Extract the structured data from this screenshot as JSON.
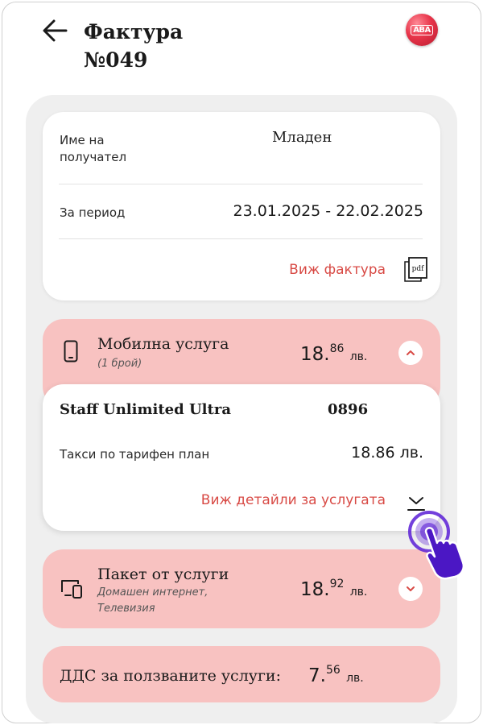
{
  "header": {
    "title_line1": "Фактура",
    "title_line2": "№049",
    "logo_text": "ABA"
  },
  "invoice": {
    "recipient_label_line1": "Име на",
    "recipient_label_line2": "получател",
    "recipient_value": "Младен",
    "period_label": "За период",
    "period_value": "23.01.2025  - 22.02.2025",
    "view_invoice_label": "Виж фактура",
    "pdf_icon_text": "pdf"
  },
  "mobile_service": {
    "title": "Мобилна услуга",
    "subtitle": "(1 брой)",
    "amount_main": "18.",
    "amount_decimals": "86",
    "currency": "лв.",
    "plan_name": "Staff Unlimited Ultra",
    "plan_code": "0896",
    "fee_label": "Такси по тарифен план",
    "fee_value": "18.86 лв.",
    "details_link": "Виж детайли за услугата"
  },
  "bundle_service": {
    "title": "Пакет от услуги",
    "subtitle_line1": "Домашен интернет,",
    "subtitle_line2": "Телевизия",
    "amount_main": "18.",
    "amount_decimals": "92",
    "currency": "лв."
  },
  "vat": {
    "label": "ДДС за ползваните услуги:",
    "amount_main": "7.",
    "amount_decimals": "56",
    "currency": "лв."
  },
  "colors": {
    "accent": "#d84a45",
    "pink_section": "#f8c2c1",
    "container_bg": "#efefef",
    "pointer_purple": "#5b1fd6"
  }
}
